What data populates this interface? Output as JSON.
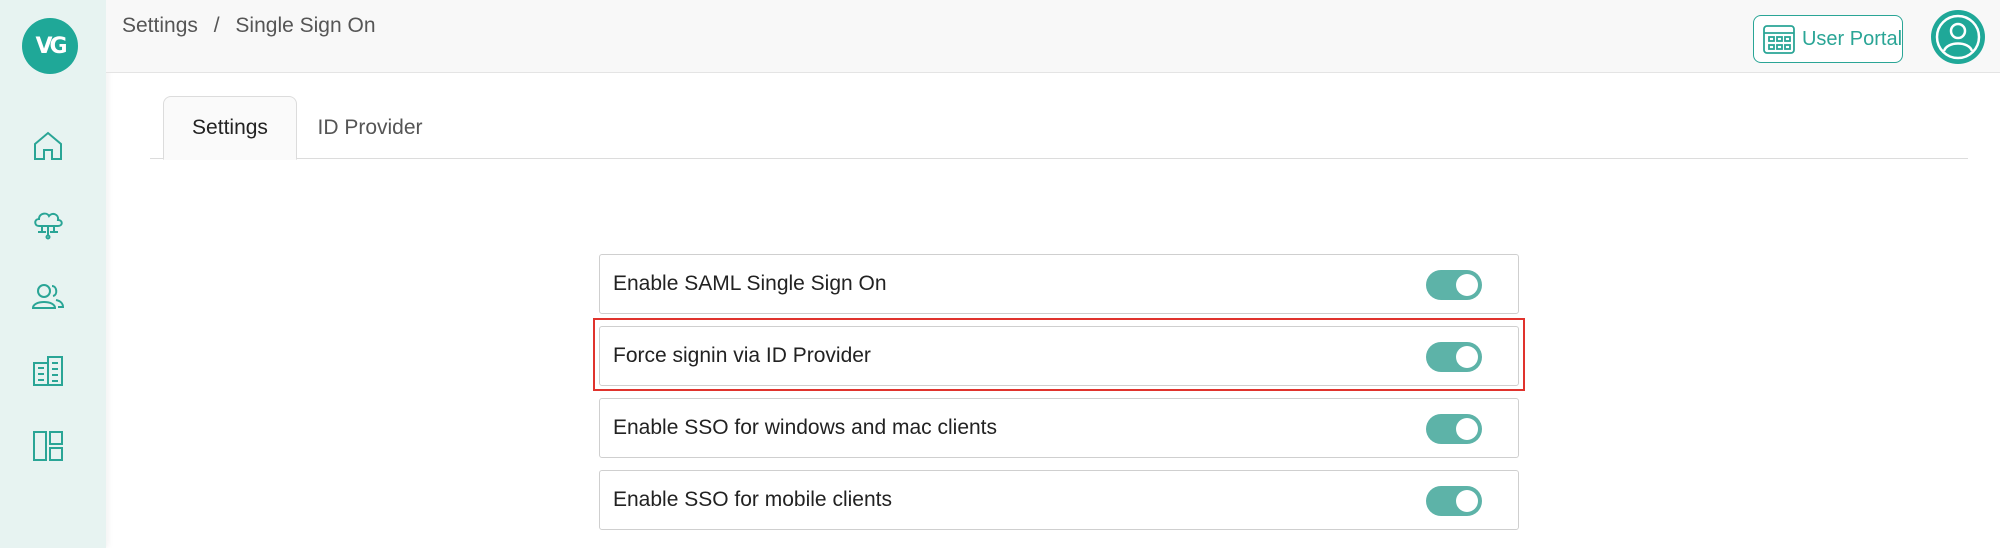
{
  "sidebar": {
    "logo_text": "VG",
    "items": [
      {
        "icon": "home-icon"
      },
      {
        "icon": "cloud-network-icon"
      },
      {
        "icon": "users-icon"
      },
      {
        "icon": "buildings-icon"
      },
      {
        "icon": "dashboard-layout-icon"
      }
    ]
  },
  "header": {
    "breadcrumb": [
      "Settings",
      "Single Sign On"
    ],
    "breadcrumb_separator": "/",
    "portal_button_label": "User Portal",
    "accent_color": "#2aa596"
  },
  "tabs": [
    {
      "label": "Settings",
      "active": true
    },
    {
      "label": "ID Provider",
      "active": false
    }
  ],
  "settings": [
    {
      "label": "Enable SAML Single Sign On",
      "enabled": true
    },
    {
      "label": "Force signin via ID Provider",
      "enabled": true,
      "highlighted": true
    },
    {
      "label": "Enable SSO for windows and mac clients",
      "enabled": true
    },
    {
      "label": "Enable SSO for mobile clients",
      "enabled": true
    }
  ],
  "colors": {
    "toggle_on": "#5db3a8",
    "highlight": "#e0332d",
    "sidebar_bg": "#e7f3f1"
  }
}
